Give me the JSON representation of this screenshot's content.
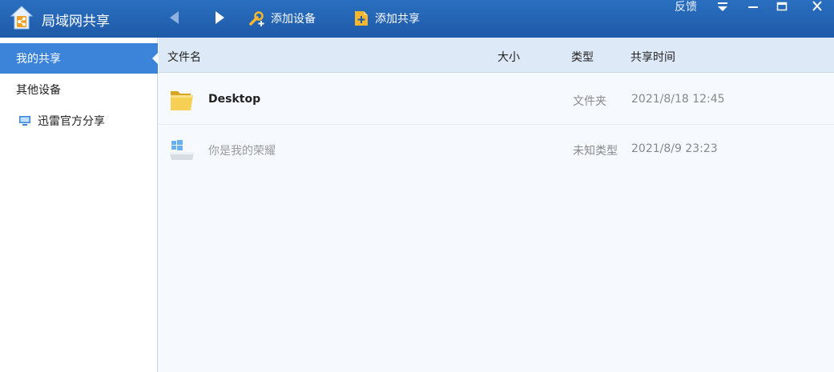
{
  "app": {
    "title": "局域网共享"
  },
  "toolbar": {
    "add_device_label": "添加设备",
    "add_share_label": "添加共享",
    "feedback_label": "反馈"
  },
  "sidebar": {
    "items": [
      {
        "label": "我的共享",
        "active": true
      },
      {
        "label": "其他设备",
        "active": false
      },
      {
        "label": "迅雷官方分享",
        "active": false,
        "icon": "computer-icon"
      }
    ]
  },
  "table": {
    "columns": [
      "文件名",
      "大小",
      "类型",
      "共享时间"
    ],
    "rows": [
      {
        "name": "Desktop",
        "size": "",
        "type": "文件夹",
        "time": "2021/8/18 12:45",
        "icon": "folder-icon"
      },
      {
        "name": "你是我的荣耀",
        "size": "",
        "type": "未知类型",
        "time": "2021/8/9 23:23",
        "icon": "windows-drive-icon"
      }
    ]
  },
  "colors": {
    "titlebar": "#1e5aa8",
    "accent": "#3b84d9",
    "header_bg": "#dde9f7"
  }
}
